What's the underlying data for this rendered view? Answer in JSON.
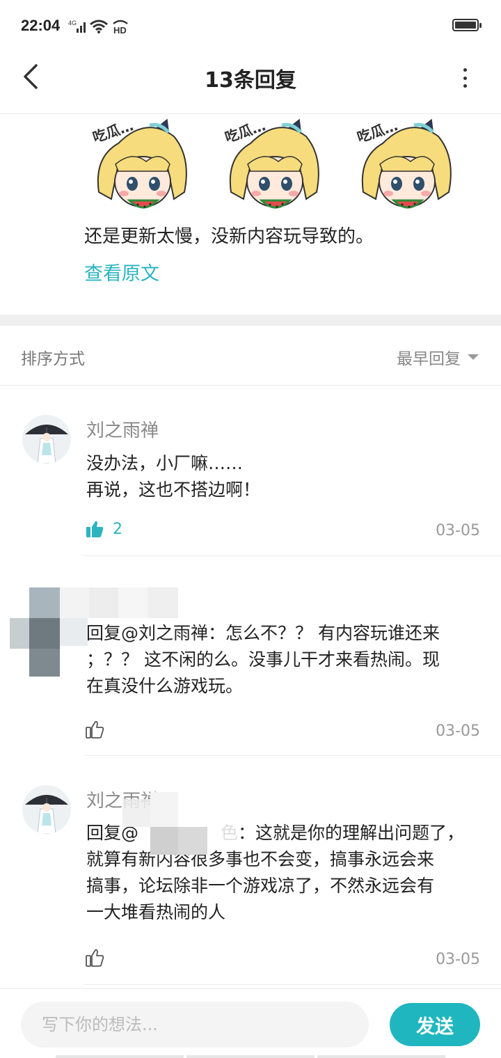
{
  "status_bar": {
    "time": "22:04",
    "network": "4G",
    "hd_badge": "HD"
  },
  "header": {
    "title": "13条回复"
  },
  "post": {
    "sticker_caption": "吃瓜…",
    "text": "还是更新太慢，没新内容玩导致的。",
    "view_original": "查看原文"
  },
  "sort": {
    "label": "排序方式",
    "selected": "最早回复"
  },
  "comments": [
    {
      "username": "刘之雨禅",
      "lines": [
        "没办法，小厂嘛……",
        "再说，这也不搭边啊！"
      ],
      "likes": "2",
      "liked": true,
      "date": "03-05"
    },
    {
      "username": "",
      "lines": [
        "回复@刘之雨禅：怎么不？？ 有内容玩谁还来",
        "；？？ 这不闲的么。没事儿干才来看热闹。现",
        "在真没什么游戏玩。"
      ],
      "likes": "",
      "liked": false,
      "date": "03-05"
    },
    {
      "username": "刘之雨禅",
      "reply_prefix": "回复@",
      "reply_visible_tail": "色",
      "reply_rest": "：这就是你的理解出问题了，",
      "lines": [
        "就算有新内容很多事也不会变，搞事永远会来",
        "搞事，论坛除非一个游戏凉了，不然永远会有",
        "一大堆看热闹的人"
      ],
      "likes": "",
      "liked": false,
      "date": "03-05"
    }
  ],
  "composer": {
    "placeholder": "写下你的想法...",
    "send_label": "发送"
  },
  "colors": {
    "accent": "#2bb4c0",
    "send_button": "#1fb6bf"
  }
}
